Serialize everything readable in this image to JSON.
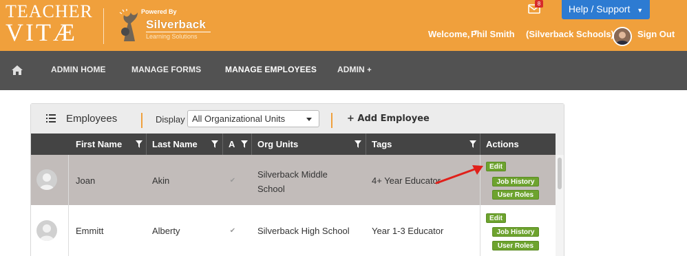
{
  "brand": {
    "logo_line1": "TEACHER",
    "logo_line2": "VITÆ",
    "powered_by": "Powered By",
    "partner_name": "Silverback",
    "partner_sub": "Learning Solutions"
  },
  "header": {
    "notification_count": "8",
    "help_label": "Help / Support",
    "welcome": "Welcome,",
    "user_name": "Phil Smith",
    "org": "(Silverback Schools)",
    "sign_out": "Sign Out"
  },
  "nav": {
    "items": [
      {
        "label": "ADMIN HOME"
      },
      {
        "label": "MANAGE FORMS"
      },
      {
        "label": "MANAGE EMPLOYEES"
      },
      {
        "label": "ADMIN"
      }
    ]
  },
  "panel": {
    "title": "Employees",
    "display_label": "Display",
    "display_value": "All Organizational Units",
    "add_label": "+ Add Employee"
  },
  "table": {
    "columns": [
      "First Name",
      "Last Name",
      "A",
      "Org Units",
      "Tags",
      "Actions"
    ],
    "rows": [
      {
        "first": "Joan",
        "last": "Akin",
        "active": "✔",
        "org_line1": "Silverback Middle",
        "org_line2": "School",
        "tag": "4+ Year Educator"
      },
      {
        "first": "Emmitt",
        "last": "Alberty",
        "active": "✔",
        "org_line1": "Silverback High School",
        "org_line2": "",
        "tag": "Year 1-3 Educator"
      }
    ],
    "actions": {
      "edit": "Edit",
      "job_history": "Job History",
      "user_roles": "User Roles"
    }
  },
  "colors": {
    "header_orange": "#f0a03c",
    "nav_gray": "#525252",
    "help_blue": "#2d7bd2",
    "action_green": "#6da32e",
    "arrow_red": "#e0201a"
  }
}
